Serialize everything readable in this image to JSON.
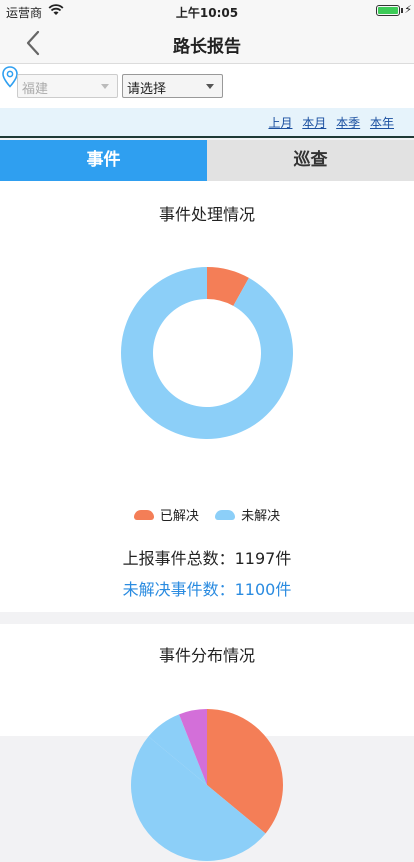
{
  "status_bar": {
    "carrier": "运营商",
    "time": "上午10:05",
    "battery_level": 1.0
  },
  "nav": {
    "title": "路长报告",
    "back_icon": "chevron-left-icon"
  },
  "filters": {
    "location_icon": "map-pin-icon",
    "province": "福建",
    "district": "请选择"
  },
  "periods": [
    "上月",
    "本月",
    "本季",
    "本年"
  ],
  "tabs": [
    {
      "label": "事件",
      "active": true
    },
    {
      "label": "巡查",
      "active": false
    }
  ],
  "event_card": {
    "title": "事件处理情况",
    "total_line": "上报事件总数：1197件",
    "unresolved_line": "未解决事件数：1100件",
    "chart_data": {
      "type": "pie",
      "series": [
        {
          "name": "已解决",
          "value": 97,
          "color": "#f47e57"
        },
        {
          "name": "未解决",
          "value": 1100,
          "color": "#8ccff8"
        }
      ]
    }
  },
  "distribution_card": {
    "title": "事件分布情况",
    "chart_data": {
      "type": "pie",
      "series": [
        {
          "value": 0.36,
          "color": "#f47e57"
        },
        {
          "value": 0.5,
          "color": "#8ccff8"
        },
        {
          "value": 0.08,
          "color": "#8ccff8"
        },
        {
          "value": 0.06,
          "color": "#d36fd9"
        }
      ]
    }
  },
  "colors": {
    "accent": "#2f9ff0",
    "resolved": "#f47e57",
    "unresolved": "#8ccff8"
  }
}
